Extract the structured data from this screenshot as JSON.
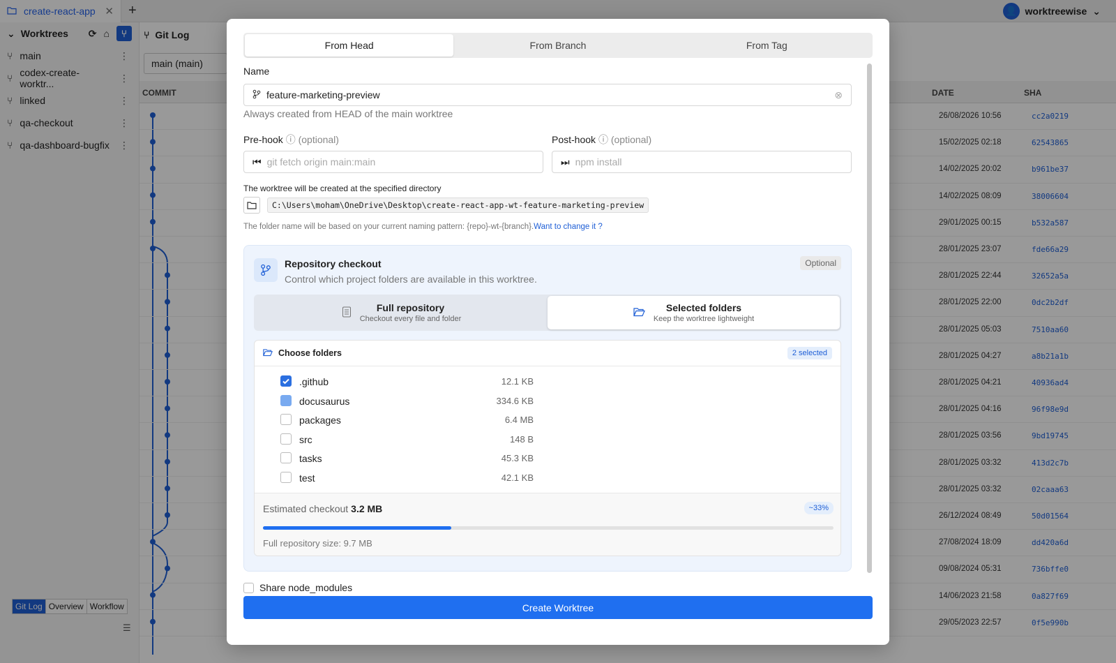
{
  "app": {
    "tab_title": "create-react-app",
    "user_name": "worktreewise"
  },
  "sidebar": {
    "header": "Worktrees",
    "items": [
      {
        "label": "main"
      },
      {
        "label": "codex-create-worktr..."
      },
      {
        "label": "linked"
      },
      {
        "label": "qa-checkout"
      },
      {
        "label": "qa-dashboard-bugfix"
      }
    ],
    "bottom_tabs": [
      "Git Log",
      "Overview",
      "Workflow"
    ]
  },
  "main": {
    "title": "Git Log",
    "branch_select": "main (main)",
    "columns": {
      "commit": "COMMIT",
      "date": "DATE",
      "sha": "SHA"
    },
    "rows": [
      {
        "date": "26/08/2026 10:56",
        "sha": "cc2a0219"
      },
      {
        "date": "15/02/2025 02:18",
        "sha": "62543865"
      },
      {
        "date": "14/02/2025 20:02",
        "sha": "b961be37"
      },
      {
        "date": "14/02/2025 08:09",
        "sha": "38006604"
      },
      {
        "date": "29/01/2025 00:15",
        "sha": "b532a587"
      },
      {
        "date": "28/01/2025 23:07",
        "sha": "fde66a29"
      },
      {
        "date": "28/01/2025 22:44",
        "sha": "32652a5a"
      },
      {
        "date": "28/01/2025 22:00",
        "sha": "0dc2b2df"
      },
      {
        "date": "28/01/2025 05:03",
        "sha": "7510aa60"
      },
      {
        "date": "28/01/2025 04:27",
        "sha": "a8b21a1b"
      },
      {
        "date": "28/01/2025 04:21",
        "sha": "40936ad4"
      },
      {
        "date": "28/01/2025 04:16",
        "sha": "96f98e9d"
      },
      {
        "date": "28/01/2025 03:56",
        "sha": "9bd19745"
      },
      {
        "date": "28/01/2025 03:32",
        "sha": "413d2c7b"
      },
      {
        "date": "28/01/2025 03:32",
        "sha": "02caaa63"
      },
      {
        "date": "26/12/2024 08:49",
        "sha": "50d01564"
      },
      {
        "date": "27/08/2024 18:09",
        "sha": "dd420a6d"
      },
      {
        "date": "09/08/2024 05:31",
        "sha": "736bffe0"
      },
      {
        "date": "14/06/2023 21:58",
        "sha": "0a827f69"
      },
      {
        "date": "29/05/2023 22:57",
        "sha": "0f5e990b"
      }
    ]
  },
  "modal": {
    "tabs": [
      "From Head",
      "From Branch",
      "From Tag"
    ],
    "name_label": "Name",
    "name_value": "feature-marketing-preview",
    "name_hint": "Always created from HEAD of the main worktree",
    "prehook_label": "Pre-hook",
    "prehook_optional": "(optional)",
    "prehook_placeholder": "git fetch origin main:main",
    "posthook_label": "Post-hook",
    "posthook_optional": "(optional)",
    "posthook_placeholder": "npm install",
    "dir_label": "The worktree will be created at the specified directory",
    "dir_path": "C:\\Users\\moham\\OneDrive\\Desktop\\create-react-app-wt-feature-marketing-preview",
    "naming_note": "The folder name will be based on your current naming pattern: {repo}-wt-{branch}.",
    "naming_link": "Want to change it ?",
    "checkout": {
      "title": "Repository checkout",
      "subtitle": "Control which project folders are available in this worktree.",
      "optional_badge": "Optional",
      "full_title": "Full repository",
      "full_sub": "Checkout every file and folder",
      "selected_title": "Selected folders",
      "selected_sub": "Keep the worktree lightweight",
      "choose_title": "Choose folders",
      "selected_badge": "2 selected",
      "folders": [
        {
          "name": ".github",
          "size": "12.1 KB",
          "state": "checked"
        },
        {
          "name": "docusaurus",
          "size": "334.6 KB",
          "state": "partial"
        },
        {
          "name": "packages",
          "size": "6.4 MB",
          "state": "none"
        },
        {
          "name": "src",
          "size": "148 B",
          "state": "none"
        },
        {
          "name": "tasks",
          "size": "45.3 KB",
          "state": "none"
        },
        {
          "name": "test",
          "size": "42.1 KB",
          "state": "none"
        }
      ],
      "estimate_label": "Estimated checkout",
      "estimate_value": "3.2 MB",
      "estimate_pct": "~33%",
      "estimate_fraction": 0.33,
      "full_size": "Full repository size: 9.7 MB"
    },
    "share_label": "Share node_modules",
    "create_button": "Create Worktree"
  }
}
